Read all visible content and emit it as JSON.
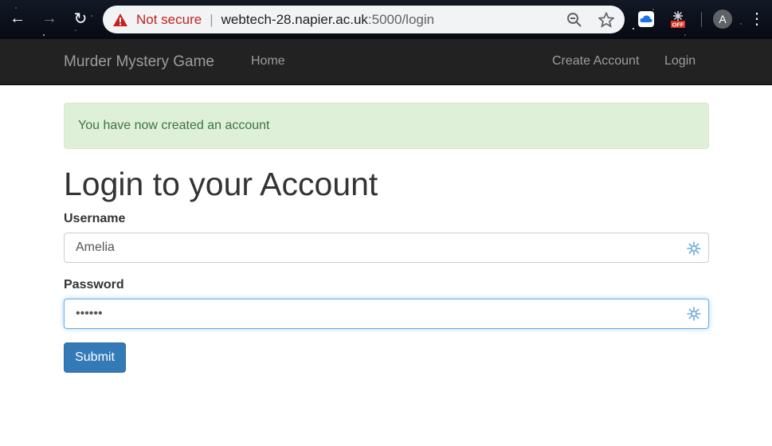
{
  "browser": {
    "back_icon": "←",
    "forward_icon": "→",
    "reload_icon": "↻",
    "security_label": "Not secure",
    "separator": "|",
    "url_host": "webtech-28.napier.ac.uk",
    "url_rest": ":5000/login",
    "profile_initial": "A",
    "menu_icon": "⋮"
  },
  "navbar": {
    "brand": "Murder Mystery Game",
    "left_links": [
      "Home"
    ],
    "right_links": [
      "Create Account",
      "Login"
    ]
  },
  "alert": {
    "message": "You have now created an account",
    "colors": {
      "background": "#dff0d8",
      "border": "#d6e9c6",
      "text": "#3c763d"
    }
  },
  "form": {
    "title": "Login to your Account",
    "username_label": "Username",
    "username_value": "Amelia",
    "password_label": "Password",
    "password_value": "••••••",
    "submit_label": "Submit"
  },
  "theme": {
    "navbar_bg": "#222222",
    "button_primary": "#337ab7",
    "focus_color": "#66afe9"
  }
}
